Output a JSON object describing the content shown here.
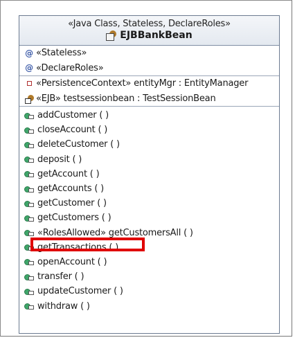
{
  "class_box": {
    "stereotypes": "«Java Class, Stateless, DeclareRoles»",
    "name": "EJBBankBean",
    "icon": "session-bean-icon"
  },
  "annotations": [
    {
      "icon": "annotation-icon",
      "glyph": "@",
      "text": "«Stateless»"
    },
    {
      "icon": "annotation-icon",
      "glyph": "@",
      "text": "«DeclareRoles»"
    }
  ],
  "fields": [
    {
      "icon": "field-icon",
      "text": "«PersistenceContext» entityMgr : EntityManager"
    },
    {
      "icon": "ejb-field-icon",
      "text": "«EJB» testsessionbean : TestSessionBean"
    }
  ],
  "operations": [
    {
      "icon": "method-icon",
      "text": "addCustomer ( )"
    },
    {
      "icon": "method-icon",
      "text": "closeAccount ( )"
    },
    {
      "icon": "method-icon",
      "text": "deleteCustomer ( )"
    },
    {
      "icon": "method-icon",
      "text": "deposit ( )"
    },
    {
      "icon": "method-icon",
      "text": "getAccount ( )"
    },
    {
      "icon": "method-icon",
      "text": "getAccounts ( )"
    },
    {
      "icon": "method-icon",
      "text": "getCustomer ( )"
    },
    {
      "icon": "method-icon",
      "text": "getCustomers ( )"
    },
    {
      "icon": "method-icon",
      "text": "«RolesAllowed» getCustomersAll ( )"
    },
    {
      "icon": "method-icon",
      "text": "getTransactions ( )"
    },
    {
      "icon": "method-icon",
      "text": "openAccount ( )"
    },
    {
      "icon": "method-icon",
      "text": "transfer ( )"
    },
    {
      "icon": "method-icon",
      "text": "updateCustomer ( )"
    },
    {
      "icon": "method-icon",
      "text": "withdraw ( )"
    }
  ],
  "highlight_color": "#e00000"
}
